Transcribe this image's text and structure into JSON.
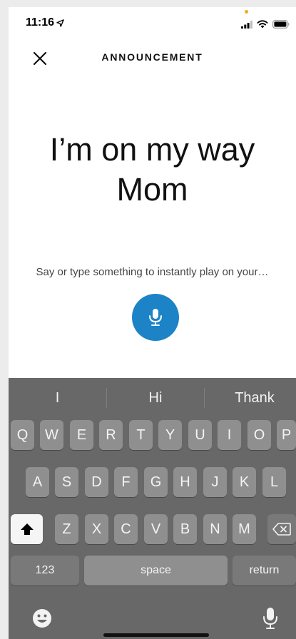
{
  "status_bar": {
    "time": "11:16"
  },
  "header": {
    "title": "ANNOUNCEMENT"
  },
  "message": {
    "line1": "I’m on my way",
    "line2": "Mom"
  },
  "hint": "Say or type something to instantly play on your…",
  "keyboard": {
    "suggestions": [
      "I",
      "Hi",
      "Thank"
    ],
    "row1": [
      "Q",
      "W",
      "E",
      "R",
      "T",
      "Y",
      "U",
      "I",
      "O",
      "P"
    ],
    "row2": [
      "A",
      "S",
      "D",
      "F",
      "G",
      "H",
      "J",
      "K",
      "L"
    ],
    "row3": [
      "Z",
      "X",
      "C",
      "V",
      "B",
      "N",
      "M"
    ],
    "numbers_key": "123",
    "space_key": "space",
    "return_key": "return"
  },
  "icons": [
    "close-icon",
    "location-arrow-icon",
    "signal-icon",
    "wifi-icon",
    "battery-icon",
    "microphone-icon",
    "shift-icon",
    "backspace-icon",
    "emoji-icon",
    "dictation-icon"
  ],
  "colors": {
    "accent": "#1c83c6",
    "keyboard_bg": "#686868",
    "key_bg": "#8f8f8f"
  }
}
